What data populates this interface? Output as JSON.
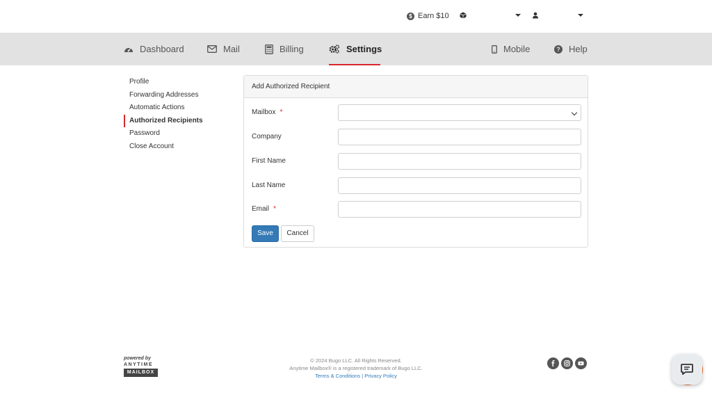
{
  "topbar": {
    "earn_label": "Earn $10",
    "earn_icon": "dollar-circle-icon",
    "account_icon": "box-icon",
    "user_icon": "user-icon"
  },
  "nav": {
    "items": [
      {
        "label": "Dashboard",
        "icon": "dashboard-icon"
      },
      {
        "label": "Mail",
        "icon": "envelope-icon"
      },
      {
        "label": "Billing",
        "icon": "calculator-icon"
      },
      {
        "label": "Settings",
        "icon": "gears-icon"
      },
      {
        "label": "Mobile",
        "icon": "mobile-icon"
      },
      {
        "label": "Help",
        "icon": "help-icon"
      }
    ],
    "active": "Settings",
    "accent_color": "#d9262d"
  },
  "sidebar": {
    "items": [
      {
        "label": "Profile"
      },
      {
        "label": "Forwarding Addresses"
      },
      {
        "label": "Automatic Actions"
      },
      {
        "label": "Authorized Recipients"
      },
      {
        "label": "Password"
      },
      {
        "label": "Close Account"
      }
    ],
    "active": "Authorized Recipients"
  },
  "form": {
    "title": "Add Authorized Recipient",
    "fields": [
      {
        "label": "Mailbox",
        "required": true,
        "value": ""
      },
      {
        "label": "Company",
        "required": false,
        "value": ""
      },
      {
        "label": "First Name",
        "required": false,
        "value": ""
      },
      {
        "label": "Last Name",
        "required": false,
        "value": ""
      },
      {
        "label": "Email",
        "required": true,
        "value": ""
      }
    ],
    "required_marker": "*",
    "save_label": "Save",
    "cancel_label": "Cancel",
    "primary_color": "#337ab7"
  },
  "footer": {
    "powered_by": "powered by",
    "brand_top": "ANYTIME",
    "brand_bottom": "MAILBOX",
    "copyright": "© 2024 Bugo LLC. All Rights Reserved.",
    "trademark": "Anytime Mailbox® is a registered trademark of Bugo LLC.",
    "terms_label": "Terms & Conditions",
    "separator": "|",
    "privacy_label": "Privacy Policy",
    "social_icons": [
      "facebook-icon",
      "instagram-icon",
      "youtube-icon"
    ],
    "chat_icon": "chat-icon"
  }
}
